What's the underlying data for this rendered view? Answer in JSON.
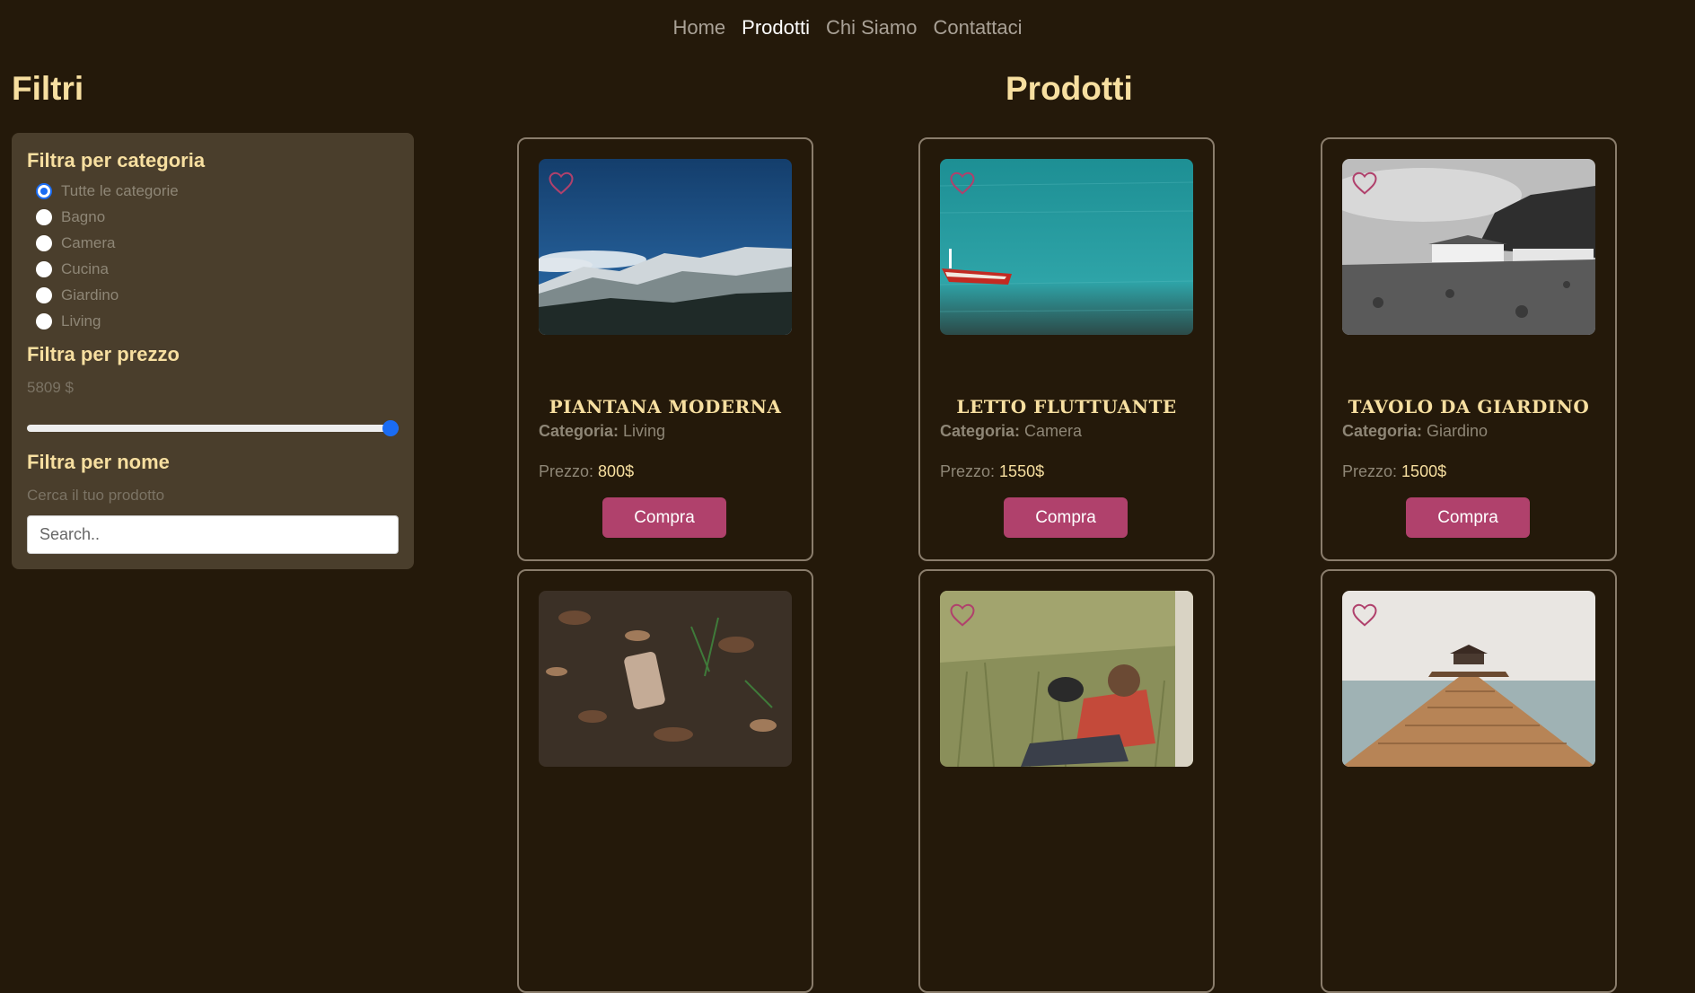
{
  "nav": {
    "items": [
      "Home",
      "Prodotti",
      "Chi Siamo",
      "Contattaci"
    ],
    "active": "Prodotti"
  },
  "filters": {
    "title": "Filtri",
    "category_heading": "Filtra per categoria",
    "categories": [
      "Tutte le categorie",
      "Bagno",
      "Camera",
      "Cucina",
      "Giardino",
      "Living"
    ],
    "selected_category": "Tutte le categorie",
    "price_heading": "Filtra per prezzo",
    "price_value": "5809 $",
    "price_slider_fraction": 1.0,
    "name_heading": "Filtra per nome",
    "name_hint": "Cerca il tuo prodotto",
    "search_placeholder": "Search.."
  },
  "products": {
    "title": "Prodotti",
    "category_label": "Categoria:",
    "price_label": "Prezzo:",
    "buy_label": "Compra",
    "items": [
      {
        "name": "PIANTANA MODERNA",
        "category": "Living",
        "price": "800$",
        "image": "snowy-mountains-photo"
      },
      {
        "name": "LETTO FLUTTUANTE",
        "category": "Camera",
        "price": "1550$",
        "image": "red-boat-on-teal-water-photo"
      },
      {
        "name": "TAVOLO DA GIARDINO",
        "category": "Giardino",
        "price": "1500$",
        "image": "coastal-houses-bw-photo"
      },
      {
        "name": "",
        "category": "",
        "price": "",
        "image": "forest-floor-leaves-photo"
      },
      {
        "name": "",
        "category": "",
        "price": "",
        "image": "man-with-dog-in-grass-photo"
      },
      {
        "name": "",
        "category": "",
        "price": "",
        "image": "wooden-pier-sea-photo"
      }
    ]
  },
  "colors": {
    "background": "#24190a",
    "panel": "#4a3e2c",
    "accent_heading": "#f7dfa0",
    "buy_button": "#b0416c",
    "heart": "#b0416c",
    "slider_thumb": "#1a6cf3"
  }
}
